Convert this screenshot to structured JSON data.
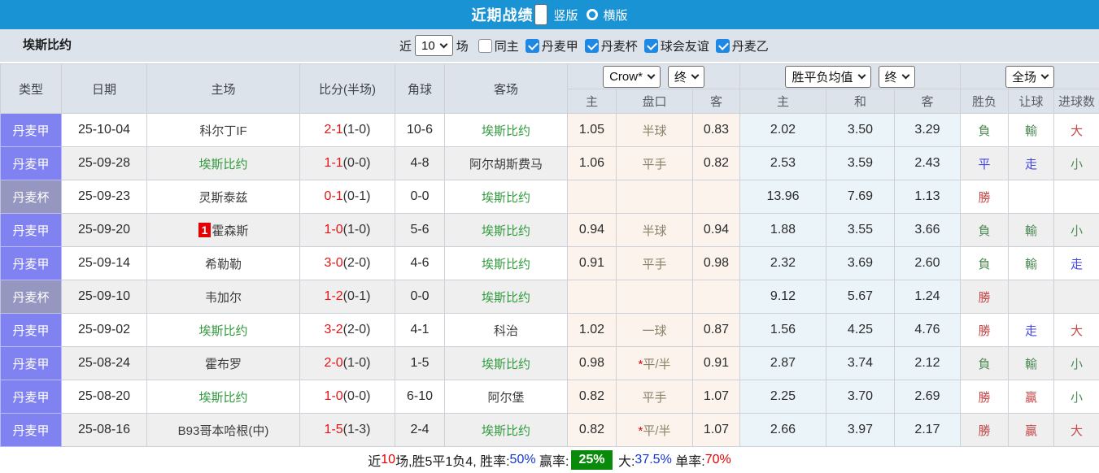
{
  "title_bar": {
    "title": "近期战绩",
    "radios": [
      {
        "label": "竖版",
        "selected": true
      },
      {
        "label": "横版",
        "selected": false
      }
    ]
  },
  "filter_bar": {
    "team": "埃斯比约",
    "recent_label": "近",
    "recent_value": "10",
    "matches_label": "场",
    "checkboxes": [
      {
        "label": "同主",
        "checked": false
      },
      {
        "label": "丹麦甲",
        "checked": true
      },
      {
        "label": "丹麦杯",
        "checked": true
      },
      {
        "label": "球会友谊",
        "checked": true
      },
      {
        "label": "丹麦乙",
        "checked": true
      }
    ]
  },
  "table": {
    "main_headers": [
      "类型",
      "日期",
      "主场",
      "比分(半场)",
      "角球",
      "客场"
    ],
    "dropdowns": {
      "odds_company": "Crow*",
      "odds_time": "终",
      "avg_type": "胜平负均值",
      "avg_time": "终",
      "scope": "全场"
    },
    "sub_headers": [
      "主",
      "盘口",
      "客",
      "主",
      "和",
      "客",
      "胜负",
      "让球",
      "进球数"
    ],
    "rows": [
      {
        "league": "丹麦甲",
        "league_class": "jia",
        "date": "25-10-04",
        "home": "科尔丁IF",
        "home_class": "",
        "home_badge": "",
        "score": "2-1",
        "half": "(1-0)",
        "corner": "10-6",
        "away": "埃斯比约",
        "away_class": "green",
        "crow_home": "1.05",
        "pan_star": "",
        "pan": "半球",
        "crow_away": "0.83",
        "avg_home": "2.02",
        "avg_draw": "3.50",
        "avg_away": "3.29",
        "res": "負",
        "res_class": "c-green",
        "let": "輸",
        "let_class": "c-green",
        "goal": "大",
        "goal_class": "c-red"
      },
      {
        "league": "丹麦甲",
        "league_class": "jia",
        "date": "25-09-28",
        "home": "埃斯比约",
        "home_class": "green",
        "home_badge": "",
        "score": "1-1",
        "half": "(0-0)",
        "corner": "4-8",
        "away": "阿尔胡斯费马",
        "away_class": "",
        "crow_home": "1.06",
        "pan_star": "",
        "pan": "平手",
        "crow_away": "0.82",
        "avg_home": "2.53",
        "avg_draw": "3.59",
        "avg_away": "2.43",
        "res": "平",
        "res_class": "c-blue",
        "let": "走",
        "let_class": "c-blue",
        "goal": "小",
        "goal_class": "c-green"
      },
      {
        "league": "丹麦杯",
        "league_class": "bei",
        "date": "25-09-23",
        "home": "灵斯泰兹",
        "home_class": "",
        "home_badge": "",
        "score": "0-1",
        "half": "(0-1)",
        "corner": "0-0",
        "away": "埃斯比约",
        "away_class": "green",
        "crow_home": "",
        "pan_star": "",
        "pan": "",
        "crow_away": "",
        "avg_home": "13.96",
        "avg_draw": "7.69",
        "avg_away": "1.13",
        "res": "勝",
        "res_class": "c-red",
        "let": "",
        "let_class": "",
        "goal": "",
        "goal_class": ""
      },
      {
        "league": "丹麦甲",
        "league_class": "jia",
        "date": "25-09-20",
        "home": "霍森斯",
        "home_class": "",
        "home_badge": "1",
        "score": "1-0",
        "half": "(1-0)",
        "corner": "5-6",
        "away": "埃斯比约",
        "away_class": "green",
        "crow_home": "0.94",
        "pan_star": "",
        "pan": "半球",
        "crow_away": "0.94",
        "avg_home": "1.88",
        "avg_draw": "3.55",
        "avg_away": "3.66",
        "res": "負",
        "res_class": "c-green",
        "let": "輸",
        "let_class": "c-green",
        "goal": "小",
        "goal_class": "c-green"
      },
      {
        "league": "丹麦甲",
        "league_class": "jia",
        "date": "25-09-14",
        "home": "希勒勒",
        "home_class": "",
        "home_badge": "",
        "score": "3-0",
        "half": "(2-0)",
        "corner": "4-6",
        "away": "埃斯比约",
        "away_class": "green",
        "crow_home": "0.91",
        "pan_star": "",
        "pan": "平手",
        "crow_away": "0.98",
        "avg_home": "2.32",
        "avg_draw": "3.69",
        "avg_away": "2.60",
        "res": "負",
        "res_class": "c-green",
        "let": "輸",
        "let_class": "c-green",
        "goal": "走",
        "goal_class": "c-blue"
      },
      {
        "league": "丹麦杯",
        "league_class": "bei",
        "date": "25-09-10",
        "home": "韦加尔",
        "home_class": "",
        "home_badge": "",
        "score": "1-2",
        "half": "(0-1)",
        "corner": "0-0",
        "away": "埃斯比约",
        "away_class": "green",
        "crow_home": "",
        "pan_star": "",
        "pan": "",
        "crow_away": "",
        "avg_home": "9.12",
        "avg_draw": "5.67",
        "avg_away": "1.24",
        "res": "勝",
        "res_class": "c-red",
        "let": "",
        "let_class": "",
        "goal": "",
        "goal_class": ""
      },
      {
        "league": "丹麦甲",
        "league_class": "jia",
        "date": "25-09-02",
        "home": "埃斯比约",
        "home_class": "green",
        "home_badge": "",
        "score": "3-2",
        "half": "(2-0)",
        "corner": "4-1",
        "away": "科治",
        "away_class": "",
        "crow_home": "1.02",
        "pan_star": "",
        "pan": "一球",
        "crow_away": "0.87",
        "avg_home": "1.56",
        "avg_draw": "4.25",
        "avg_away": "4.76",
        "res": "勝",
        "res_class": "c-red",
        "let": "走",
        "let_class": "c-blue",
        "goal": "大",
        "goal_class": "c-red"
      },
      {
        "league": "丹麦甲",
        "league_class": "jia",
        "date": "25-08-24",
        "home": "霍布罗",
        "home_class": "",
        "home_badge": "",
        "score": "2-0",
        "half": "(1-0)",
        "corner": "1-5",
        "away": "埃斯比约",
        "away_class": "green",
        "crow_home": "0.98",
        "pan_star": "*",
        "pan": "平/半",
        "crow_away": "0.91",
        "avg_home": "2.87",
        "avg_draw": "3.74",
        "avg_away": "2.12",
        "res": "負",
        "res_class": "c-green",
        "let": "輸",
        "let_class": "c-green",
        "goal": "小",
        "goal_class": "c-green"
      },
      {
        "league": "丹麦甲",
        "league_class": "jia",
        "date": "25-08-20",
        "home": "埃斯比约",
        "home_class": "green",
        "home_badge": "",
        "score": "1-0",
        "half": "(0-0)",
        "corner": "6-10",
        "away": "阿尔堡",
        "away_class": "",
        "crow_home": "0.82",
        "pan_star": "",
        "pan": "平手",
        "crow_away": "1.07",
        "avg_home": "2.25",
        "avg_draw": "3.70",
        "avg_away": "2.69",
        "res": "勝",
        "res_class": "c-red",
        "let": "贏",
        "let_class": "c-red",
        "goal": "小",
        "goal_class": "c-green"
      },
      {
        "league": "丹麦甲",
        "league_class": "jia",
        "date": "25-08-16",
        "home": "B93哥本哈根(中)",
        "home_class": "",
        "home_badge": "",
        "score": "1-5",
        "half": "(1-3)",
        "corner": "2-4",
        "away": "埃斯比约",
        "away_class": "green",
        "crow_home": "0.82",
        "pan_star": "*",
        "pan": "平/半",
        "crow_away": "1.07",
        "avg_home": "2.66",
        "avg_draw": "3.97",
        "avg_away": "2.17",
        "res": "勝",
        "res_class": "c-red",
        "let": "贏",
        "let_class": "c-red",
        "goal": "大",
        "goal_class": "c-red"
      }
    ]
  },
  "summary": {
    "segments": [
      {
        "text": "近",
        "cls": ""
      },
      {
        "text": "10",
        "cls": "red"
      },
      {
        "text": "场,胜5平1负4, 胜率:",
        "cls": ""
      },
      {
        "text": "50%",
        "cls": "blue"
      },
      {
        "text": " 赢率:",
        "cls": ""
      },
      {
        "text": "25%",
        "cls": "greenbox"
      },
      {
        "text": " 大:",
        "cls": ""
      },
      {
        "text": "37.5%",
        "cls": "blue"
      },
      {
        "text": " 单率:",
        "cls": ""
      },
      {
        "text": "70%",
        "cls": "red"
      }
    ]
  }
}
